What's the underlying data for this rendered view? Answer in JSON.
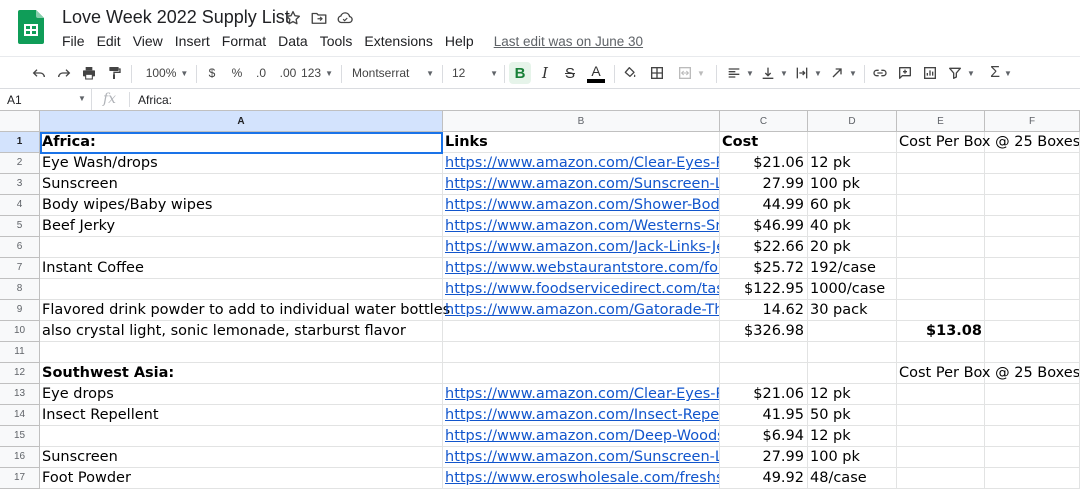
{
  "app": {
    "title": "Love Week 2022 Supply List",
    "menu": [
      "File",
      "Edit",
      "View",
      "Insert",
      "Format",
      "Data",
      "Tools",
      "Extensions",
      "Help"
    ],
    "last_edit": "Last edit was on June 30"
  },
  "toolbar": {
    "zoom": "100%",
    "currency": "$",
    "percent": "%",
    "decrease_decimal": ".0",
    "increase_decimal": ".00",
    "number_format": "123",
    "font": "Montserrat",
    "font_size": "12",
    "bold": "B",
    "italic": "I",
    "strikethrough": "S",
    "text_color": "A",
    "text_color_value": "#000000",
    "function": "Σ"
  },
  "formula_bar": {
    "cell_ref": "A1",
    "fx": "fx",
    "content": "Africa:"
  },
  "grid": {
    "columns": [
      "A",
      "B",
      "C",
      "D",
      "E",
      "F"
    ],
    "active_column": "A",
    "active_row": 1,
    "link_color": "#1155cc",
    "selection_color": "#1a73e8",
    "rows": [
      {
        "num": "1",
        "a": "Africa:",
        "b": "Links",
        "c": "Cost",
        "d": "",
        "e": "Cost Per Box @ 25 Boxes"
      },
      {
        "num": "2",
        "a": "Eye Wash/drops",
        "b": "https://www.amazon.com/Clear-Eyes-Re",
        "c": "$21.06",
        "d": "12 pk",
        "e": ""
      },
      {
        "num": "3",
        "a": "Sunscreen",
        "b": "https://www.amazon.com/Sunscreen-Lo",
        "c": "27.99",
        "d": "100 pk",
        "e": ""
      },
      {
        "num": "4",
        "a": "Body wipes/Baby wipes",
        "b": "https://www.amazon.com/Shower-Body",
        "c": "44.99",
        "d": "60 pk",
        "e": ""
      },
      {
        "num": "5",
        "a": "Beef Jerky",
        "b": "https://www.amazon.com/Westerns-Sm",
        "c": "$46.99",
        "d": "40 pk",
        "e": ""
      },
      {
        "num": "6",
        "a": "",
        "b": "https://www.amazon.com/Jack-Links-Je",
        "c": "$22.66",
        "d": "20 pk",
        "e": ""
      },
      {
        "num": "7",
        "a": "Instant Coffee",
        "b": "https://www.webstaurantstore.com/folg",
        "c": "$25.72",
        "d": "192/case",
        "e": ""
      },
      {
        "num": "8",
        "a": "",
        "b": "https://www.foodservicedirect.com/tast",
        "c": "$122.95",
        "d": "1000/case",
        "e": ""
      },
      {
        "num": "9",
        "a": "Flavored drink powder to add to individual water bottles",
        "b": "https://www.amazon.com/Gatorade-Thi",
        "c": "14.62",
        "d": "30 pack",
        "e": ""
      },
      {
        "num": "10",
        "a": "also crystal light, sonic lemonade, starburst flavor",
        "b": "",
        "c": "$326.98",
        "d": "",
        "e": "$13.08"
      },
      {
        "num": "11",
        "a": "",
        "b": "",
        "c": "",
        "d": "",
        "e": ""
      },
      {
        "num": "12",
        "a": "Southwest Asia:",
        "b": "",
        "c": "",
        "d": "",
        "e": "Cost Per Box @ 25 Boxes"
      },
      {
        "num": "13",
        "a": "Eye drops",
        "b": "https://www.amazon.com/Clear-Eyes-Re",
        "c": "$21.06",
        "d": "12 pk",
        "e": ""
      },
      {
        "num": "14",
        "a": "Insect Repellent",
        "b": "https://www.amazon.com/Insect-Repell",
        "c": "41.95",
        "d": "50 pk",
        "e": ""
      },
      {
        "num": "15",
        "a": "",
        "b": "https://www.amazon.com/Deep-Woods",
        "c": "$6.94",
        "d": "12 pk",
        "e": ""
      },
      {
        "num": "16",
        "a": "Sunscreen",
        "b": "https://www.amazon.com/Sunscreen-Lo",
        "c": "27.99",
        "d": "100 pk",
        "e": ""
      },
      {
        "num": "17",
        "a": "Foot Powder",
        "b": "https://www.eroswholesale.com/freshsc",
        "c": "49.92",
        "d": "48/case",
        "e": ""
      }
    ]
  }
}
